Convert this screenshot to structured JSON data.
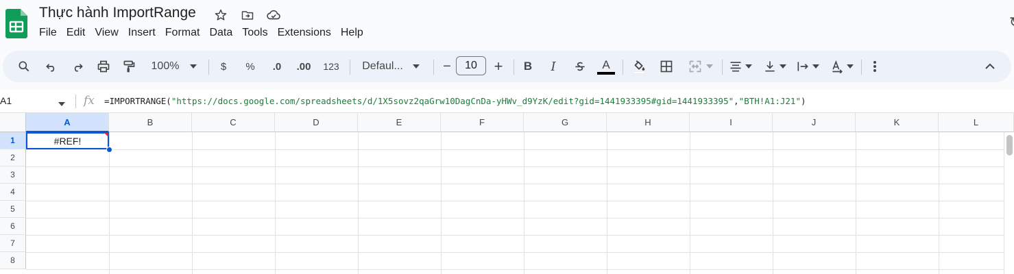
{
  "app": {
    "brand_color": "#0f9d58",
    "accent_color": "#0b57d0"
  },
  "doc": {
    "title": "Thực hành ImportRange",
    "icons": [
      "star-icon",
      "move-to-folder-icon",
      "cloud-saved-icon"
    ]
  },
  "menu": [
    "File",
    "Edit",
    "View",
    "Insert",
    "Format",
    "Data",
    "Tools",
    "Extensions",
    "Help"
  ],
  "toolbar": {
    "zoom": "100%",
    "currency": "$",
    "percent": "%",
    "decrease_decimal": ".0",
    "increase_decimal": ".00",
    "number_format": "123",
    "font": "Defaul...",
    "font_size": "10",
    "minus": "−",
    "plus": "+",
    "bold": "B",
    "italic": "I",
    "text_color": "A"
  },
  "formula_bar": {
    "cell_ref": "A1",
    "fx": "fx",
    "func": "=IMPORTRANGE(",
    "arg1": "\"https://docs.google.com/spreadsheets/d/1X5sovz2qaGrw10DagCnDa-yHWv_d9YzK/edit?gid=1441933395#gid=1441933395\"",
    "comma": ",",
    "arg2": "\"BTH!A1:J21\"",
    "close": ")"
  },
  "sheet": {
    "columns": [
      "A",
      "B",
      "C",
      "D",
      "E",
      "F",
      "G",
      "H",
      "I",
      "J",
      "K",
      "L"
    ],
    "rows": [
      "1",
      "2",
      "3",
      "4",
      "5",
      "6",
      "7",
      "8"
    ],
    "selected_cell": "A1",
    "cells": {
      "A1": "#REF!"
    },
    "error_color": "#d93025"
  }
}
